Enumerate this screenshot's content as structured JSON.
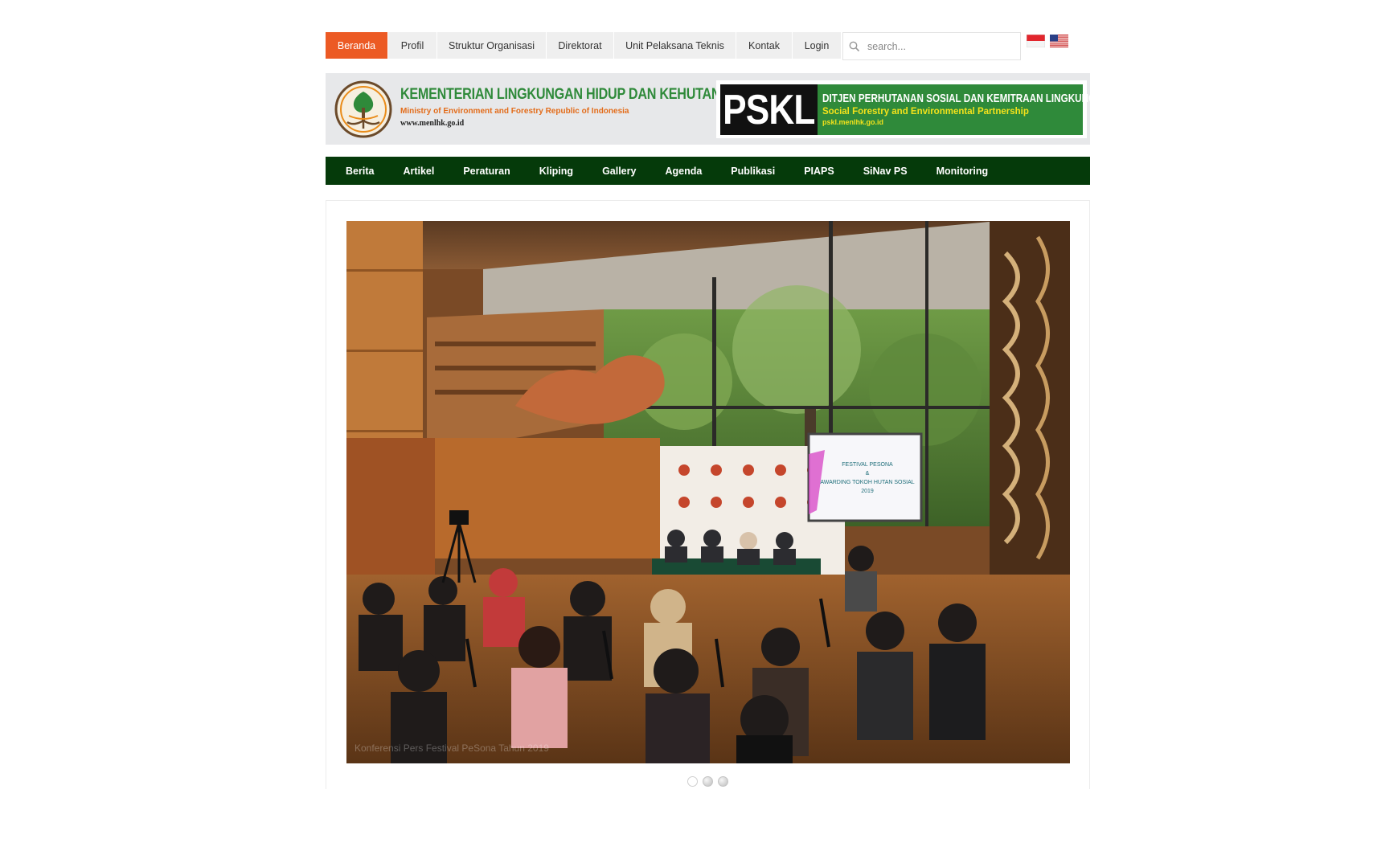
{
  "topnav": {
    "items": [
      {
        "label": "Beranda",
        "active": true
      },
      {
        "label": "Profil",
        "active": false
      },
      {
        "label": "Struktur Organisasi",
        "active": false
      },
      {
        "label": "Direktorat",
        "active": false
      },
      {
        "label": "Unit Pelaksana Teknis",
        "active": false
      },
      {
        "label": "Kontak",
        "active": false
      },
      {
        "label": "Login",
        "active": false
      }
    ],
    "search_placeholder": "search...",
    "languages": [
      "indonesia-flag-icon",
      "usa-flag-icon"
    ]
  },
  "header": {
    "ministry_title": "KEMENTERIAN LINGKUNGAN HIDUP DAN KEHUTANAN",
    "ministry_subtitle": "Ministry of Environment and Forestry Republic of Indonesia",
    "ministry_url": "www.menlhk.go.id",
    "pskl_logo": "PSKL",
    "pskl_title": "DITJEN PERHUTANAN SOSIAL DAN KEMITRAAN LINGKUNGAN",
    "pskl_subtitle": "Social Forestry  and Environmental Partnership",
    "pskl_url": "pskl.menlhk.go.id"
  },
  "mainnav": {
    "items": [
      "Berita",
      "Artikel",
      "Peraturan",
      "Kliping",
      "Gallery",
      "Agenda",
      "Publikasi",
      "PIAPS",
      "SiNav PS",
      "Monitoring"
    ]
  },
  "slider": {
    "caption": "Konferensi Pers Festival PeSona Tahun 2019",
    "screen_text": [
      "FESTIVAL PESONA",
      "&",
      "AWARDING TOKOH HUTAN SOSIAL",
      "2019"
    ],
    "slide_count": 3,
    "active_index": 0
  },
  "colors": {
    "accent_orange": "#ec5a24",
    "nav_green": "#053a0a",
    "brand_green": "#2f8a3a"
  }
}
